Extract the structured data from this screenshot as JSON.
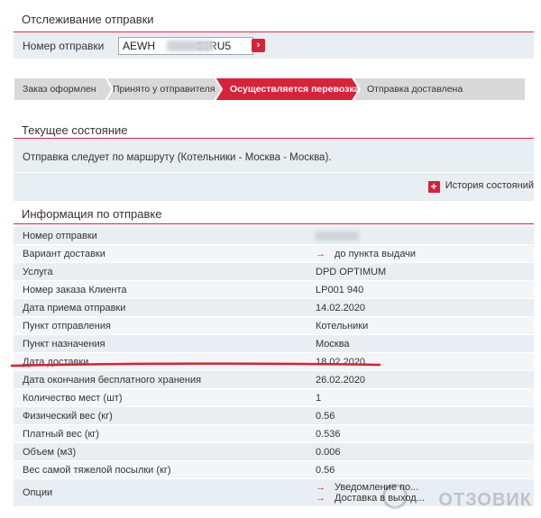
{
  "header": {
    "title": "Отслеживание отправки"
  },
  "tracking": {
    "label": "Номер отправки",
    "value": "AEWH              93RU5",
    "go_icon": "chevron-right-icon"
  },
  "steps": [
    {
      "label": "Заказ оформлен",
      "active": false
    },
    {
      "label": "Принято у отправителя",
      "active": false
    },
    {
      "label": "Осуществляется перевозка",
      "active": true
    },
    {
      "label": "Отправка доставлена",
      "active": false
    }
  ],
  "status": {
    "title": "Текущее состояние",
    "text": "Отправка следует по маршруту (Котельники - Москва - Москва).",
    "history_label": "История состояний",
    "history_icon": "plus-icon"
  },
  "info": {
    "title": "Информация по отправке",
    "rows": [
      {
        "label": "Номер отправки",
        "value": ""
      },
      {
        "label": "Вариант доставки",
        "value": "до пункта выдачи",
        "arrow": true
      },
      {
        "label": "Услуга",
        "value": "DPD OPTIMUM"
      },
      {
        "label": "Номер заказа Клиента",
        "value": "LP001          940"
      },
      {
        "label": "Дата приема отправки",
        "value": "14.02.2020"
      },
      {
        "label": "Пункт отправления",
        "value": "Котельники"
      },
      {
        "label": "Пункт назначения",
        "value": "Москва"
      },
      {
        "label": "Дата доставки",
        "value": "18.02.2020"
      },
      {
        "label": "Дата окончания бесплатного хранения",
        "value": "26.02.2020"
      },
      {
        "label": "Количество мест (шт)",
        "value": "1"
      },
      {
        "label": "Физический вес (кг)",
        "value": "0.56"
      },
      {
        "label": "Платный вес (кг)",
        "value": "0.536"
      },
      {
        "label": "Объем (м3)",
        "value": "0.006"
      },
      {
        "label": "Вес самой тяжелой посылки (кг)",
        "value": "0.56"
      },
      {
        "label": "Опции",
        "value": "Уведомление по...",
        "value2": "Доставка в выход...",
        "arrow": true
      }
    ]
  },
  "watermark": "ОТЗОВИК",
  "colors": {
    "accent": "#d8223a",
    "panel": "#e9eef3"
  }
}
